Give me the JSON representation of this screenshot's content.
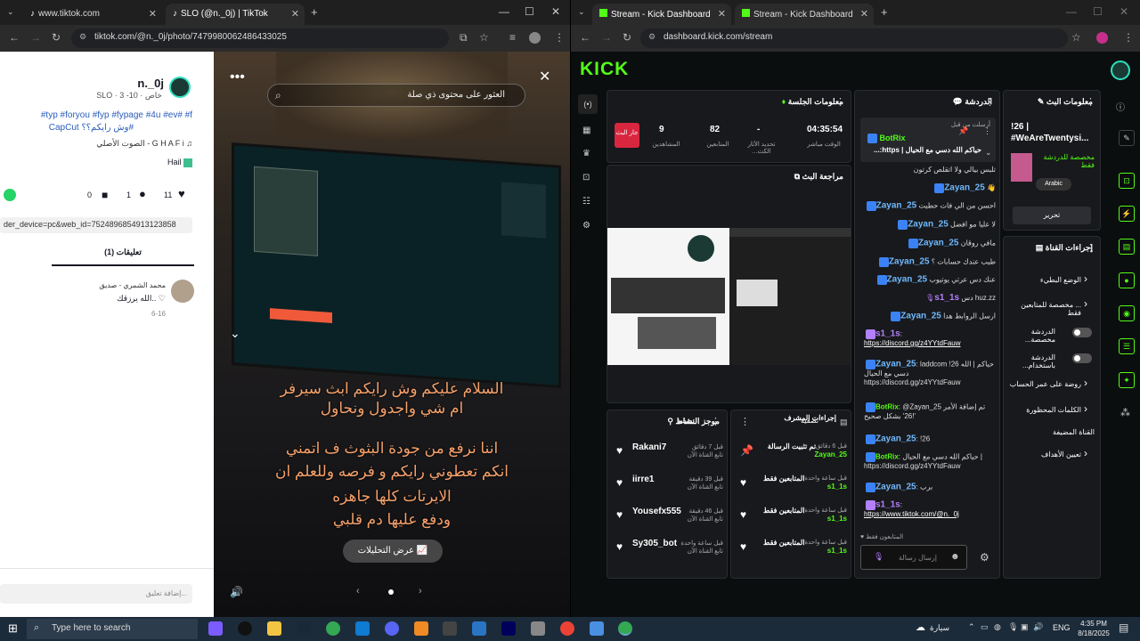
{
  "left_browser": {
    "tabs": [
      {
        "label": "www.tiktok.com"
      },
      {
        "label": "SLO (@n._0j) | TikTok"
      }
    ],
    "url": "tiktok.com/@n._0j/photo/7479980062486433025"
  },
  "tiktok": {
    "username": "n._0j",
    "meta": "SLO · 3 -10 · خاص",
    "hashtags": "#typ #foryou #fyp #fypage #4u #ev# #f",
    "hashtags2": "CapCut وش رايكم؟؟#",
    "sound": "الصوت الأصلي - G H A F i",
    "tag": "Hail",
    "likes": "11",
    "comments": "1",
    "saves": "0",
    "url_fragment": "der_device=pc&web_id=7524896854913123858",
    "comments_tab": "تعليقات (1)",
    "commenter_name": "محمد الشمري - صديق",
    "comment_text": "الله يرزقك.. ♡",
    "comment_date": "6-16",
    "add_comment_placeholder": "إضافة تعليق...",
    "search_placeholder": "العثور على محتوى ذي صلة",
    "caption_lines": [
      "السلام عليكم وش رايكم ابث سيرفر",
      "ام شي واجدول ونحاول",
      "اننا نرفع من جودة البثوث ف اتمني",
      "انكم تعطوني رايكم و فرصه وللعلم ان",
      "الايرتات كلها جاهزه",
      "ودفع عليها دم قلبي"
    ],
    "view_analytics": "عرض التحليلات"
  },
  "right_browser": {
    "tabs": [
      {
        "label": "Stream - Kick Dashboard"
      },
      {
        "label": "Stream - Kick Dashboard"
      }
    ],
    "url": "dashboard.kick.com/stream"
  },
  "kick": {
    "logo": "KICK",
    "session_title": "معلومات الجلسة",
    "live_badge": "جار البث",
    "stats": [
      {
        "value": "04:35:54",
        "label": "الوقت مباشر"
      },
      {
        "value": "-",
        "label": "تحديد الأثار الكث..."
      },
      {
        "value": "82",
        "label": "المتابعين"
      },
      {
        "value": "9",
        "label": "المشاهدين"
      }
    ],
    "preview_title": "مراجعة البث",
    "chat_title": "الدردشة",
    "pinned_label": "أرسلت من قبل",
    "pinned_user": "BotRix",
    "pinned_text": "حياكم الله دسي مع الحيال | https:...",
    "chat": [
      {
        "user": "",
        "text": "تلبس بيالي ولا اتقلص كرتون"
      },
      {
        "user": "Zayan_25",
        "text": "👋"
      },
      {
        "user": "Zayan_25",
        "text": "احسن من الي فات حطيت"
      },
      {
        "user": "Zayan_25",
        "text": "لا عليا مو افضل"
      },
      {
        "user": "Zayan_25",
        "text": "مافي روقان"
      },
      {
        "user": "Zayan_25",
        "text": "طيب عندك حسابات ؟"
      },
      {
        "user": "Zayan_25",
        "text": "عنك دس عرتي يوتيوب"
      },
      {
        "user": "s1_1s",
        "text": "huz.zz دس"
      },
      {
        "user": "Zayan_25",
        "text": "ارسل الروابط هدا"
      },
      {
        "user": "s1_1s",
        "text": "https://discord.gg/z4YYtdFauw"
      },
      {
        "user": "Zayan_25",
        "text": "laddcom !26 حياكم | الله دسي مع الحيال https://discord.gg/z4YYtdFauw"
      },
      {
        "user": "BotRix",
        "text": "@Zayan_25 تم إضافة الأمر '!26' بشكل صحيح"
      },
      {
        "user": "Zayan_25",
        "text": "!26"
      },
      {
        "user": "BotRix",
        "text": "حياكم الله دسي مع الحيال | https://discord.gg/z4YYtdFauw"
      },
      {
        "user": "Zayan_25",
        "text": "برب"
      },
      {
        "user": "s1_1s",
        "text": "https://www.tiktok.com/@n._0j"
      }
    ],
    "chat_mode": "المتابعون فقط",
    "chat_placeholder": "إرسال رسالة",
    "activity_title": "موجز النشاط",
    "activity_filter": "تصفية",
    "activity": [
      {
        "name": "Rakani7",
        "sub": "تابع القناة الآن",
        "time": "قبل 7 دقائق"
      },
      {
        "name": "iirre1",
        "sub": "تابع القناة الآن",
        "time": "قبل 39 دقيقة"
      },
      {
        "name": "Yousefx555",
        "sub": "تابع القناة الآن",
        "time": "قبل 46 دقيقة"
      },
      {
        "name": "Sy305_bot",
        "sub": "تابع القناة الآن",
        "time": "قبل ساعة واحدة"
      }
    ],
    "modactions_title": "إجراءات المشرف",
    "modactions": [
      {
        "title": "تم تثبيت الرسالة",
        "user": "Zayan_25",
        "time": "قبل 6 دقائق"
      },
      {
        "title": "المتابعين فقط",
        "user": "s1_1s",
        "time": "قبل ساعة واحدة"
      },
      {
        "title": "المتابعين فقط",
        "user": "s1_1s",
        "time": "قبل ساعة واحدة"
      },
      {
        "title": "المتابعين فقط",
        "user": "s1_1s",
        "time": "قبل ساعة واحدة"
      }
    ],
    "streaminfo_title": "معلومات البث",
    "stream_title": "!26 | #WeAreTwentysi...",
    "stream_category": "مخصصة للدردشة فقط",
    "stream_lang": "Arabic",
    "edit_button": "تحرير",
    "channel_actions_title": "إجراءات القناة",
    "channel_actions": [
      {
        "label": "الوضع البطيء",
        "control": "arrow"
      },
      {
        "label": "... مخصصة للمتابعين فقط",
        "control": "arrow"
      },
      {
        "label": "الدردشة مخصصة...",
        "control": "toggle"
      },
      {
        "label": "الدردشة باستخدام...",
        "control": "toggle"
      },
      {
        "label": "روضة على عمر الحساب",
        "control": "arrow"
      },
      {
        "label": "الكلمات المحظورة",
        "control": "arrow"
      },
      {
        "label": "القناة المضيفة",
        "control": "none"
      },
      {
        "label": "تعيين الأهداف",
        "control": "arrow"
      }
    ]
  },
  "taskbar": {
    "search_placeholder": "Type here to search",
    "weather": "سيارة",
    "lang": "ENG",
    "time": "4:35 PM",
    "date": "8/18/2025"
  },
  "colors": {
    "kick_green": "#53fc18",
    "tiktok_red": "#fe2c55",
    "panel_bg": "#18191c"
  }
}
